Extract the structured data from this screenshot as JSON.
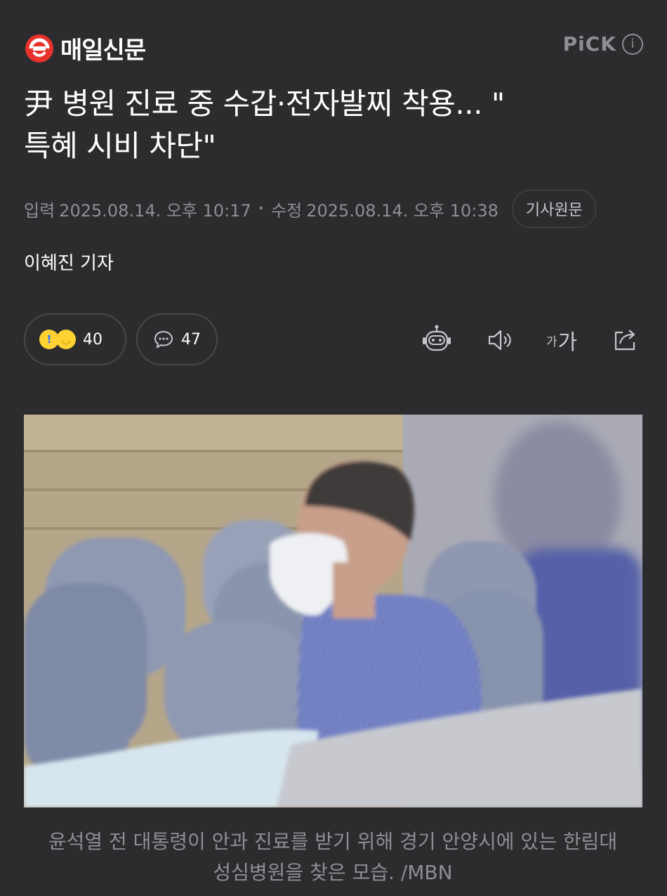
{
  "header": {
    "brand": "매일신문",
    "pick_label": "PiCK",
    "info_icon": "info-icon"
  },
  "article": {
    "headline_line1": "尹 병원 진료 중 수갑·전자발찌 착용... \"",
    "headline_line2": "특혜 시비 차단\"",
    "published_label": "입력",
    "published_time": "2025.08.14. 오후 10:17",
    "modified_label": "수정",
    "modified_time": "2025.08.14. 오후 10:38",
    "origin_button": "기사원문",
    "reporter": "이혜진 기자"
  },
  "actions": {
    "reaction_count": "40",
    "comment_count": "47",
    "font_small": "가",
    "font_large": "가",
    "icons": [
      "summary-bot-icon",
      "text-to-speech-icon",
      "font-size-icon",
      "share-icon"
    ]
  },
  "photo": {
    "caption_line1": "윤석열 전 대통령이 안과 진료를 받기 위해 경기 안양시에 있는 한림대",
    "caption_line2": "성심병원을 찾은 모습. /MBN"
  },
  "colors": {
    "background": "#2c2c2e",
    "text": "#ffffff",
    "muted": "#8e8e93",
    "brand_red": "#e8322c"
  }
}
